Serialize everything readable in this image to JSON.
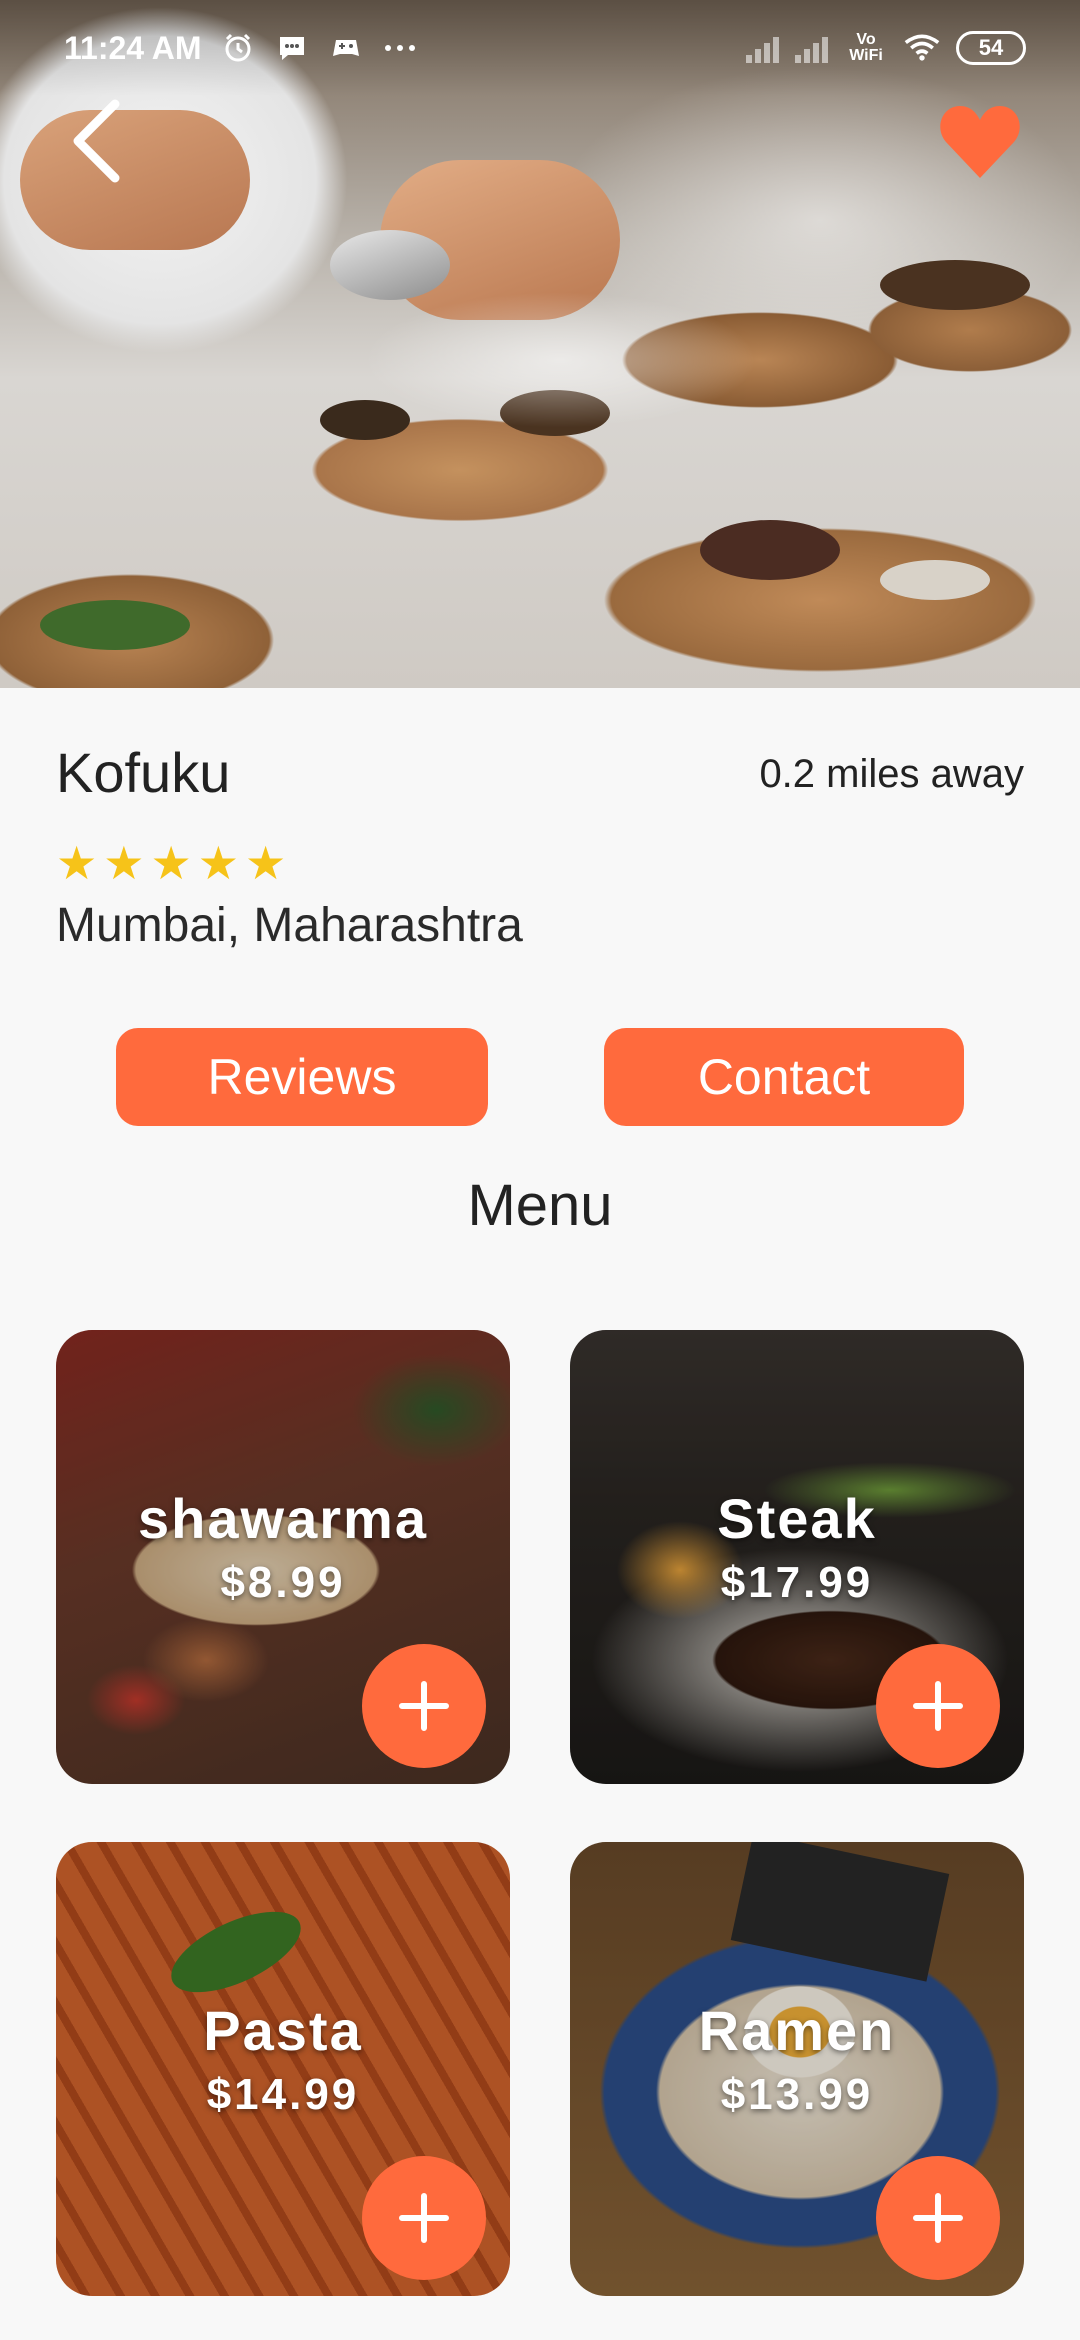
{
  "status_bar": {
    "time": "11:24 AM",
    "icons": [
      "alarm-icon",
      "message-icon",
      "game-icon",
      "more-dots-icon"
    ],
    "network_label": "Vo WiFi",
    "battery": "54"
  },
  "header": {
    "back_icon": "chevron-left-icon",
    "favorite_icon": "heart-icon",
    "favorite_color": "#ff6a3d"
  },
  "restaurant": {
    "name": "Kofuku",
    "distance": "0.2 miles away",
    "rating": 5,
    "rating_max": 5,
    "star_color": "#f6c319",
    "location": "Mumbai, Maharashtra"
  },
  "actions": {
    "reviews_label": "Reviews",
    "contact_label": "Contact",
    "accent_color": "#ff6a3d"
  },
  "menu": {
    "title": "Menu",
    "items": [
      {
        "name": "shawarma",
        "price": "$8.99"
      },
      {
        "name": "Steak",
        "price": "$17.99"
      },
      {
        "name": "Pasta",
        "price": "$14.99"
      },
      {
        "name": "Ramen",
        "price": "$13.99"
      }
    ],
    "add_icon": "plus-icon"
  }
}
